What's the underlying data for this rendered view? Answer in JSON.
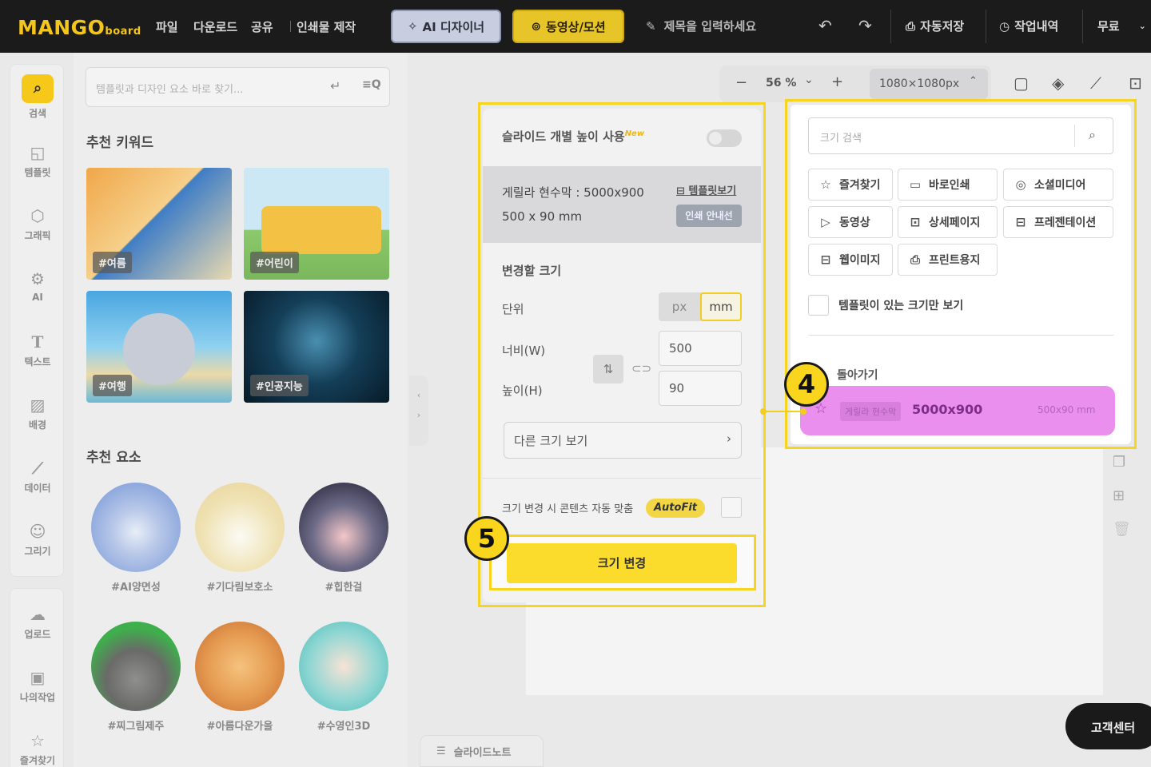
{
  "topbar": {
    "logo_main": "MANGO",
    "logo_sub": "board",
    "menu": [
      "파일",
      "다운로드",
      "공유",
      "인쇄물 제작"
    ],
    "ai_designer": "AI 디자이너",
    "video_motion": "동영상/모션",
    "title_placeholder": "제목을 입력하세요",
    "autosave": "자동저장",
    "history": "작업내역",
    "plan": "무료"
  },
  "rail": {
    "items": [
      "검색",
      "템플릿",
      "그래픽",
      "AI",
      "텍스트",
      "배경",
      "데이터",
      "그리기"
    ],
    "bottom_items": [
      "업로드",
      "나의작업",
      "즐겨찾기"
    ]
  },
  "panel": {
    "search_placeholder": "템플릿과 디자인 요소 바로 찾기...",
    "keywords_title": "추천 키워드",
    "keywords": [
      "#여름",
      "#어린이",
      "#여행",
      "#인공지능"
    ],
    "elements_title": "추천 요소",
    "elements": [
      "#AI양면성",
      "#기다림보호소",
      "#힙한걸",
      "#찌그림제주",
      "#아름다운가을",
      "#수영인3D"
    ]
  },
  "canvas": {
    "zoom": "56 %",
    "size_label": "1080×1080px",
    "slide_note": "슬라이드노트",
    "help": "고객센터"
  },
  "resize_panel": {
    "individual_height": "슬라이드 개별 높이 사용",
    "new_badge": "New",
    "current_name": "게릴라 현수막 : 5000x900",
    "current_mm": "500 x 90 mm",
    "template_link": "템플릿보기",
    "print_guide": "인쇄 안내선",
    "change_size_title": "변경할 크기",
    "unit_label": "단위",
    "unit_px": "px",
    "unit_mm": "mm",
    "width_label": "너비(W)",
    "height_label": "높이(H)",
    "width_value": "500",
    "height_value": "90",
    "other_sizes": "다른 크기 보기",
    "autofit_label": "크기 변경 시 콘텐츠 자동 맞춤",
    "autofit_badge": "AutoFit",
    "resize_button": "크기 변경"
  },
  "size_picker": {
    "search_placeholder": "크기 검색",
    "categories": [
      "즐겨찾기",
      "바로인쇄",
      "소셜미디어",
      "동영상",
      "상세페이지",
      "프레젠테이션",
      "웹이미지",
      "프린트용지"
    ],
    "only_with_templates": "템플릿이 있는 크기만 보기",
    "back": "돌아가기",
    "result_category": "게릴라 현수막",
    "result_size": "5000x900",
    "result_mm": "500x90 mm"
  },
  "steps": [
    "4",
    "5"
  ],
  "colors": {
    "accent": "#f9d51e",
    "highlight": "#ea8fee",
    "topbar": "#1b1b1b"
  }
}
